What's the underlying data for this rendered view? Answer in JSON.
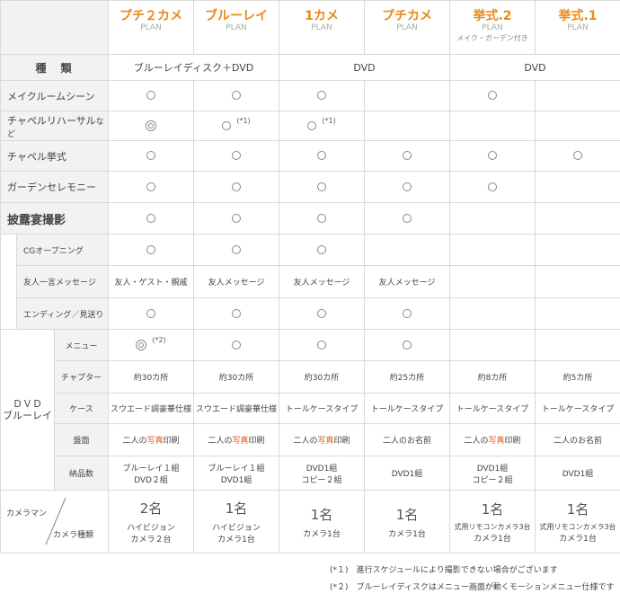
{
  "plans": [
    {
      "name": "プチ２カメ",
      "en": "PLAN",
      "note": ""
    },
    {
      "name": "ブルーレイ",
      "en": "PLAN",
      "note": ""
    },
    {
      "name": "1カメ",
      "en": "PLAN",
      "note": ""
    },
    {
      "name": "プチカメ",
      "en": "PLAN",
      "note": ""
    },
    {
      "name": "挙式.2",
      "en": "PLAN",
      "note": "メイク・ガーデン付き"
    },
    {
      "name": "挙式.1",
      "en": "PLAN",
      "note": ""
    }
  ],
  "type_row": {
    "label": "種　類",
    "bluray_dvd": "ブルーレイディスク＋DVD",
    "dvd1": "DVD",
    "dvd2": "DVD"
  },
  "rows": {
    "makeup": "メイクルームシーン",
    "rehearsal": "チャペルリハーサル",
    "rehearsal_suffix": "など",
    "chapel": "チャペル挙式",
    "garden": "ガーデンセレモニー",
    "reception": "披露宴撮影",
    "cg": "CGオープニング",
    "message": "友人一言メッセージ",
    "ending": "エンディング／見送り",
    "dvd_group": "ＤＶＤ",
    "dvd_group2": "ブルーレイ",
    "menu": "メニュー",
    "chapter": "チャプター",
    "case": "ケース",
    "disc": "盤面",
    "count": "納品数",
    "cameraman": "カメラマン",
    "camera_type": "カメラ種類"
  },
  "notes": {
    "n1": "(*1)",
    "n2": "(*2)"
  },
  "message_vals": [
    "友人・ゲスト・親戚",
    "友人メッセージ",
    "友人メッセージ",
    "友人メッセージ"
  ],
  "chapter_vals": [
    "約30カ所",
    "約30カ所",
    "約30カ所",
    "約25カ所",
    "約8カ所",
    "約5カ所"
  ],
  "case_vals": [
    "スウエード調豪華仕様",
    "スウエード調豪華仕様",
    "トールケースタイプ",
    "トールケースタイプ",
    "トールケースタイプ",
    "トールケースタイプ"
  ],
  "disc": {
    "pre": "二人の",
    "hl": "写真",
    "post": "印刷",
    "plain": "二人のお名前"
  },
  "count_vals": [
    {
      "a": "ブルーレイ１組",
      "b": "DVD２組"
    },
    {
      "a": "ブルーレイ１組",
      "b": "DVD1組"
    },
    {
      "a": "DVD1組",
      "b": "コピー２組"
    },
    {
      "a": "DVD1組",
      "b": ""
    },
    {
      "a": "DVD1組",
      "b": "コピー２組"
    },
    {
      "a": "DVD1組",
      "b": ""
    }
  ],
  "cam_vals": [
    {
      "num": "2名",
      "l1": "ハイビジョン",
      "l2": "カメラ２台"
    },
    {
      "num": "1名",
      "l1": "ハイビジョン",
      "l2": "カメラ1台"
    },
    {
      "num": "1名",
      "l1": "カメラ1台",
      "l2": ""
    },
    {
      "num": "1名",
      "l1": "カメラ1台",
      "l2": ""
    },
    {
      "num": "1名",
      "l1": "式用リモコンカメラ3台",
      "l2": "カメラ1台"
    },
    {
      "num": "1名",
      "l1": "式用リモコンカメラ3台",
      "l2": "カメラ1台"
    }
  ],
  "footnotes": [
    "(*１)　進行スケジュールにより撮影できない場合がございます",
    "(*２)　ブルーレイディスクはメニュー画面が動くモーションメニュー仕様です"
  ]
}
